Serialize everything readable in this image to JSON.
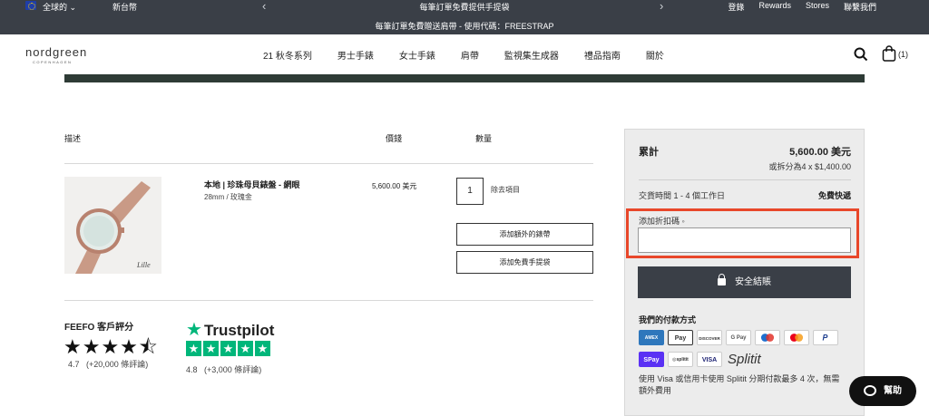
{
  "topbar": {
    "region": "全球的",
    "currency": "新台幣",
    "promo_primary": "每筆訂單免費提供手提袋",
    "promo_secondary": "每筆訂單免費贈送肩帶 - 使用代碼：FREESTRAP",
    "links": [
      "登錄",
      "Rewards",
      "Stores",
      "聯繫我們"
    ]
  },
  "nav": {
    "logo": "nordgreen",
    "logo_sub": "COPENHAGEN",
    "menu": [
      "21 秋冬系列",
      "男士手錶",
      "女士手錶",
      "肩帶",
      "監視集生成器",
      "禮品指南",
      "關於"
    ],
    "cart_count": "(1)"
  },
  "cart": {
    "headers": {
      "description": "描述",
      "price": "價錢",
      "quantity": "數量"
    },
    "item": {
      "name": "本地 | 珍珠母貝錶盤 - 網眼",
      "variant": "28mm / 玫瑰金",
      "price": "5,600.00 美元",
      "quantity": "1",
      "remove": "除去項目",
      "image_caption": "Lille"
    },
    "buttons": {
      "extra_strap": "添加額外的錶帶",
      "free_bag": "添加免費手提袋"
    }
  },
  "reviews": {
    "feefo_title": "FEEFO 客戶評分",
    "feefo_rating": "4.7",
    "feefo_count": "(+20,000 條評論)",
    "trustpilot_name": "Trustpilot",
    "trustpilot_rating": "4.8",
    "trustpilot_count": "(+3,000 條評論)"
  },
  "summary": {
    "total_label": "累計",
    "total_value": "5,600.00 美元",
    "split_text": "或拆分為4 x $1,400.00",
    "delivery_label": "交貨時間 1 - 4 個工作日",
    "delivery_value": "免費快遞",
    "discount_label": "添加折扣碼 ◦",
    "checkout_label": "安全結賬",
    "payment_title": "我們的付款方式",
    "payment_row1": [
      "AMEX",
      "Pay",
      "DISCOVER",
      "G Pay",
      "MC",
      "MA",
      "PayPal"
    ],
    "payment_row2": [
      "Pay",
      "splitit",
      "VISA"
    ],
    "splitit_text": "Splitit",
    "note": "使用 Visa 或信用卡使用 Splitit 分期付款最多 4 次，無需額外費用"
  },
  "help": {
    "label": "幫助"
  }
}
